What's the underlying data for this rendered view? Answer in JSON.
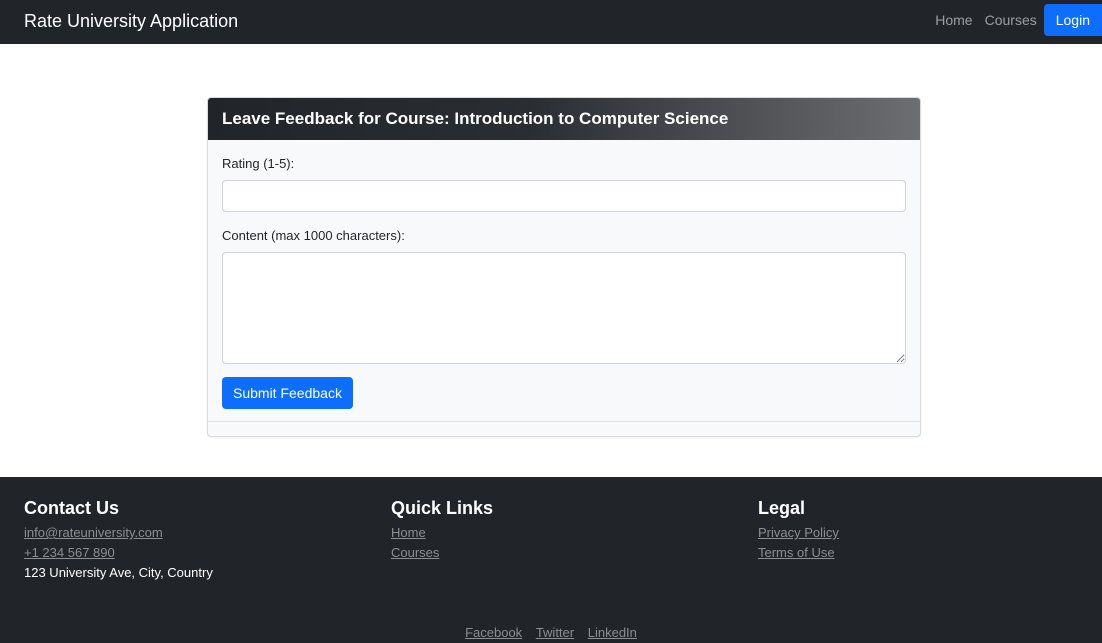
{
  "navbar": {
    "brand": "Rate University Application",
    "links": [
      "Home",
      "Courses"
    ],
    "login_label": "Login"
  },
  "feedback_form": {
    "title": "Leave Feedback for Course: Introduction to Computer Science",
    "rating_label": "Rating (1-5):",
    "rating_value": "",
    "content_label": "Content (max 1000 characters):",
    "content_value": "",
    "submit_label": "Submit Feedback"
  },
  "footer": {
    "contact": {
      "heading": "Contact Us",
      "email": "info@rateuniversity.com",
      "phone": "+1 234 567 890",
      "address": "123 University Ave, City, Country"
    },
    "quick_links": {
      "heading": "Quick Links",
      "items": [
        "Home",
        "Courses"
      ]
    },
    "legal": {
      "heading": "Legal",
      "items": [
        "Privacy Policy",
        "Terms of Use"
      ]
    },
    "social": [
      "Facebook",
      "Twitter",
      "LinkedIn"
    ]
  },
  "colors": {
    "navbar_bg": "#212529",
    "primary": "#0d6efd",
    "footer_link": "#8a8f94"
  }
}
